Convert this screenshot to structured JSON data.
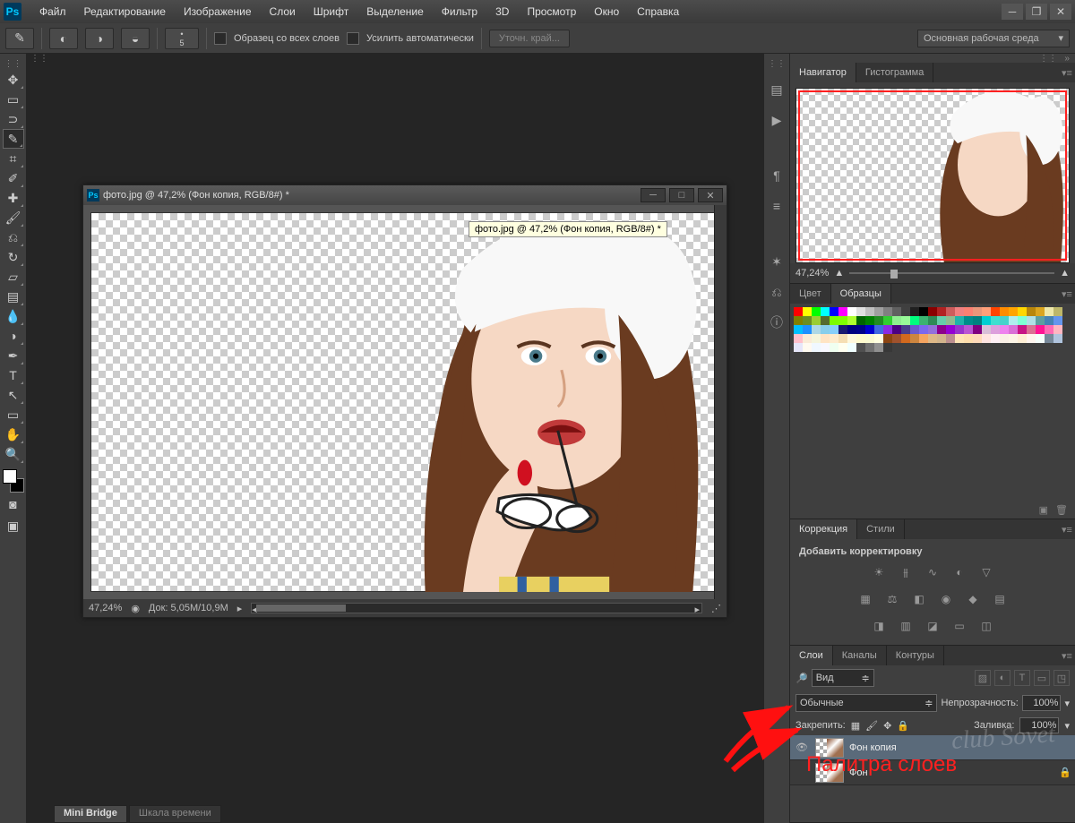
{
  "menu": {
    "items": [
      "Файл",
      "Редактирование",
      "Изображение",
      "Слои",
      "Шрифт",
      "Выделение",
      "Фильтр",
      "3D",
      "Просмотр",
      "Окно",
      "Справка"
    ]
  },
  "options": {
    "brush_size": "5",
    "cb1": "Образец со всех слоев",
    "cb2": "Усилить автоматически",
    "refine": "Уточн. край...",
    "workspace": "Основная рабочая среда"
  },
  "tools": [
    {
      "name": "move-tool",
      "g": "✥"
    },
    {
      "name": "marquee-tool",
      "g": "▭"
    },
    {
      "name": "lasso-tool",
      "g": "⊃"
    },
    {
      "name": "quick-select-tool",
      "g": "✎",
      "active": true
    },
    {
      "name": "crop-tool",
      "g": "⌗"
    },
    {
      "name": "eyedropper-tool",
      "g": "✐"
    },
    {
      "name": "healing-brush-tool",
      "g": "✚"
    },
    {
      "name": "brush-tool",
      "g": "🖌"
    },
    {
      "name": "stamp-tool",
      "g": "⎌"
    },
    {
      "name": "history-brush-tool",
      "g": "↻"
    },
    {
      "name": "eraser-tool",
      "g": "▱"
    },
    {
      "name": "gradient-tool",
      "g": "▤"
    },
    {
      "name": "blur-tool",
      "g": "💧"
    },
    {
      "name": "dodge-tool",
      "g": "◑"
    },
    {
      "name": "pen-tool",
      "g": "✒"
    },
    {
      "name": "type-tool",
      "g": "T"
    },
    {
      "name": "path-select-tool",
      "g": "↖"
    },
    {
      "name": "rectangle-tool",
      "g": "▭"
    },
    {
      "name": "hand-tool",
      "g": "✋"
    },
    {
      "name": "zoom-tool",
      "g": "🔍"
    }
  ],
  "document": {
    "title": "фото.jpg @ 47,2% (Фон копия, RGB/8#) *",
    "tooltip": "фото.jpg @ 47,2% (Фон копия, RGB/8#) *",
    "status_zoom": "47,24%",
    "status_doc": "Док:  5,05M/10,9M"
  },
  "navigator": {
    "tab1": "Навигатор",
    "tab2": "Гистограмма",
    "zoom": "47,24%"
  },
  "swatches": {
    "tab1": "Цвет",
    "tab2": "Образцы",
    "colors": [
      "#ff0000",
      "#ffff00",
      "#00ff00",
      "#00ffff",
      "#0000ff",
      "#ff00ff",
      "#ffffff",
      "#e0e0e0",
      "#c0c0c0",
      "#a0a0a0",
      "#808080",
      "#606060",
      "#404040",
      "#202020",
      "#000000",
      "#8b0000",
      "#b22222",
      "#cd5c5c",
      "#f08080",
      "#fa8072",
      "#e9967a",
      "#ffa07a",
      "#ff4500",
      "#ff8c00",
      "#ffa500",
      "#ffd700",
      "#b8860b",
      "#daa520",
      "#eee8aa",
      "#bdb76b",
      "#808000",
      "#6b8e23",
      "#9acd32",
      "#556b2f",
      "#7cfc00",
      "#7fff00",
      "#adff2f",
      "#006400",
      "#008000",
      "#228b22",
      "#32cd32",
      "#90ee90",
      "#98fb98",
      "#00ff7f",
      "#3cb371",
      "#2e8b57",
      "#66cdaa",
      "#8fbc8f",
      "#20b2aa",
      "#008b8b",
      "#008080",
      "#00ced1",
      "#40e0d0",
      "#48d1cc",
      "#afeeee",
      "#7fffd4",
      "#b0e0e6",
      "#5f9ea0",
      "#4682b4",
      "#6495ed",
      "#00bfff",
      "#1e90ff",
      "#add8e6",
      "#87ceeb",
      "#87cefa",
      "#191970",
      "#000080",
      "#00008b",
      "#0000cd",
      "#4169e1",
      "#8a2be2",
      "#4b0082",
      "#483d8b",
      "#6a5acd",
      "#7b68ee",
      "#9370db",
      "#8b008b",
      "#9400d3",
      "#9932cc",
      "#ba55d3",
      "#800080",
      "#d8bfd8",
      "#dda0dd",
      "#ee82ee",
      "#da70d6",
      "#c71585",
      "#db7093",
      "#ff1493",
      "#ff69b4",
      "#ffb6c1",
      "#ffc0cb",
      "#faebd7",
      "#f5f5dc",
      "#ffe4c4",
      "#ffebcd",
      "#f5deb3",
      "#fff8dc",
      "#fffacd",
      "#fafad2",
      "#ffffe0",
      "#8b4513",
      "#a0522d",
      "#d2691e",
      "#cd853f",
      "#f4a460",
      "#deb887",
      "#d2b48c",
      "#bc8f8f",
      "#ffe4b5",
      "#ffdead",
      "#ffdab9",
      "#ffe4e1",
      "#fff0f5",
      "#faf0e6",
      "#fdf5e6",
      "#ffefd5",
      "#fff5ee",
      "#f5fffa",
      "#778899",
      "#b0c4de",
      "#e6e6fa",
      "#fffaf0",
      "#f0f8ff",
      "#f8f8ff",
      "#f0fff0",
      "#fffff0",
      "#f0ffff",
      "#505050",
      "#707070",
      "#909090",
      "#383838"
    ]
  },
  "correction": {
    "tab1": "Коррекция",
    "tab2": "Стили",
    "add": "Добавить корректировку"
  },
  "layers_panel": {
    "tab1": "Слои",
    "tab2": "Каналы",
    "tab3": "Контуры",
    "kind": "Вид",
    "blend": "Обычные",
    "opacity_label": "Непрозрачность:",
    "opacity": "100%",
    "lock_label": "Закрепить:",
    "fill_label": "Заливка:",
    "fill": "100%",
    "layers": [
      {
        "name": "Фон копия",
        "visible": true,
        "selected": true,
        "locked": false
      },
      {
        "name": "Фон",
        "visible": false,
        "selected": false,
        "locked": true
      }
    ]
  },
  "bottom": {
    "tab1": "Mini Bridge",
    "tab2": "Шкала времени"
  },
  "annotation": {
    "text": "Палитра слоев",
    "watermark": "club Sovet"
  }
}
